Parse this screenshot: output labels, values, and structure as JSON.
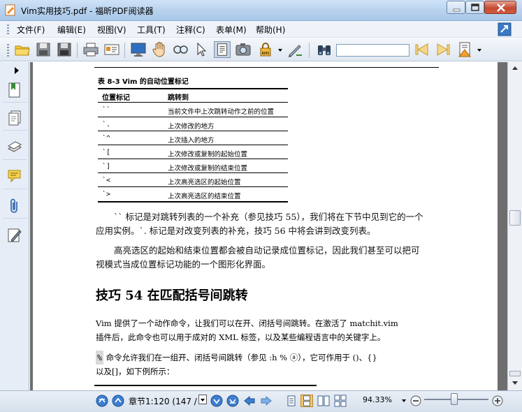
{
  "window": {
    "title": "Vim实用技巧.pdf - 福昕PDF阅读器"
  },
  "menu": {
    "items": [
      "文件(F)",
      "编辑(E)",
      "视图(V)",
      "工具(T)",
      "注释(C)",
      "表单(M)",
      "帮助(H)"
    ]
  },
  "toolbar": {
    "find_value": ""
  },
  "document": {
    "table_caption": "表 8-3   Vim 的自动位置标记",
    "table_headers": [
      "位置标记",
      "跳转到"
    ],
    "table_rows": [
      {
        "mark": "``",
        "target": "当前文件中上次跳转动作之前的位置"
      },
      {
        "mark": "`.",
        "target": "上次修改的地方"
      },
      {
        "mark": "`^",
        "target": "上次插入的地方"
      },
      {
        "mark": "`[",
        "target": "上次修改或复制的起始位置"
      },
      {
        "mark": "`]",
        "target": "上次修改或复制的结束位置"
      },
      {
        "mark": "`<",
        "target": "上次高亮选区的起始位置"
      },
      {
        "mark": "`>",
        "target": "上次高亮选区的结束位置"
      }
    ],
    "para1_line1": "`` 标记是对跳转列表的一个补充（参见技巧 55），我们将在下节中见到它的一个",
    "para1_line2": "应用实例。`. 标记是对改变列表的补充，技巧 56 中将会讲到改变列表。",
    "para2_line1": "高亮选区的起始和结束位置都会被自动记录成位置标记，因此我们甚至可以把可",
    "para2_line2": "视模式当成位置标记功能的一个图形化界面。",
    "heading": "技巧 54   在匹配括号间跳转",
    "para3_line1": "Vim 提供了一个动作命令，让我们可以在开、闭括号间跳转。在激活了 matchit.vim",
    "para3_line2": "插件后，此命令也可以用于成对的 XML 标签，以及某些编程语言中的关键字上。",
    "para4_pct": "%",
    "para4_line1": "命令允许我们在一组开、闭括号间跳转（参见 :h % ⓐ），它可作用于 ()、{}",
    "para4_line2": "以及[]，如下例所示："
  },
  "status": {
    "chapter": "章节1:120 (147 /",
    "zoom": "94.33%"
  }
}
